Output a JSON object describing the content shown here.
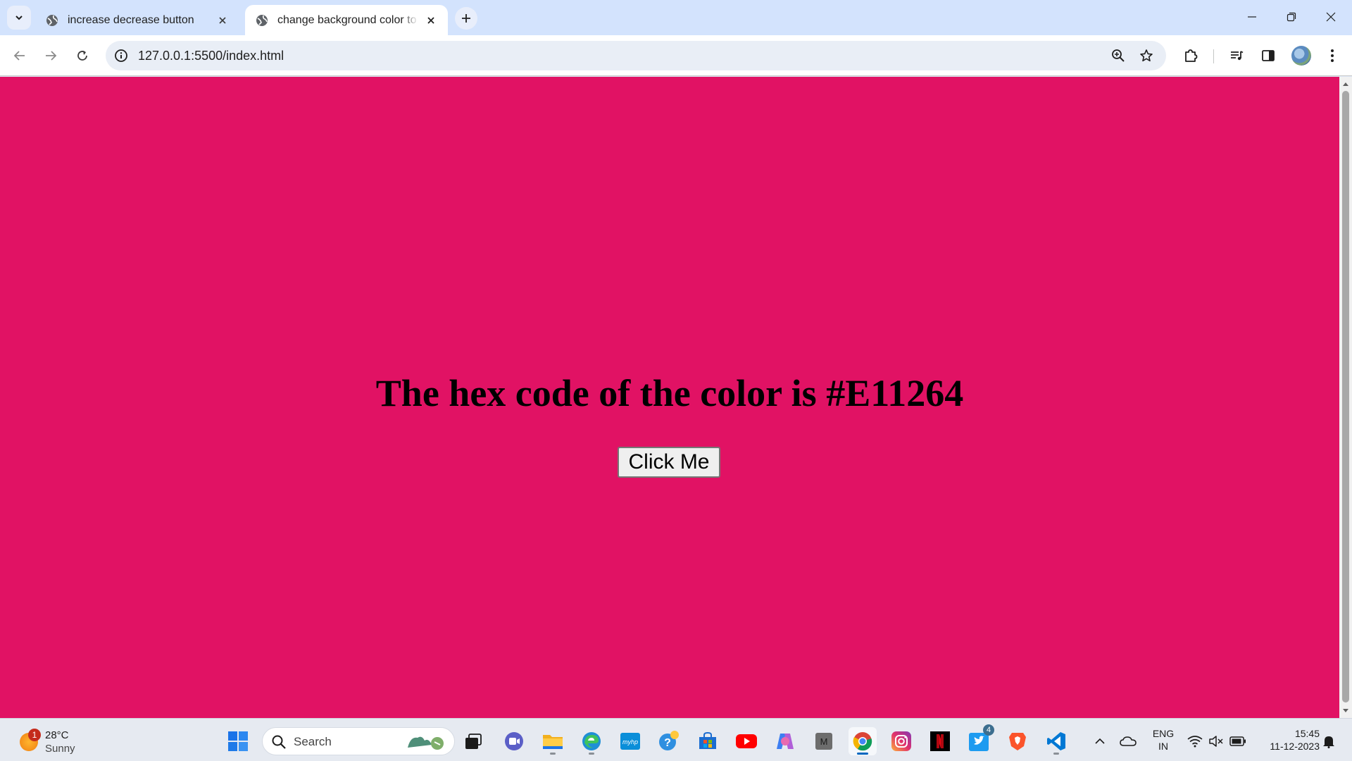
{
  "browser": {
    "tabs": [
      {
        "title": "increase decrease button",
        "active": false
      },
      {
        "title": "change background color to button",
        "active": true
      }
    ],
    "url": "127.0.0.1:5500/index.html"
  },
  "page": {
    "background_color": "#E11264",
    "heading": "The hex code of the color is #E11264",
    "button_label": "Click Me"
  },
  "taskbar": {
    "weather": {
      "temperature": "28°C",
      "condition": "Sunny",
      "badge": "1"
    },
    "search_placeholder": "Search",
    "pinned_apps": [
      "file-explorer",
      "teams-meet",
      "files",
      "edge",
      "myhp",
      "get-help",
      "microsoft-store",
      "youtube",
      "copilot",
      "m-app",
      "chrome",
      "instagram",
      "netflix",
      "twitter",
      "brave",
      "vscode"
    ],
    "twitter_badge": "4",
    "language": {
      "line1": "ENG",
      "line2": "IN"
    },
    "clock": {
      "time": "15:45",
      "date": "11-12-2023"
    }
  }
}
